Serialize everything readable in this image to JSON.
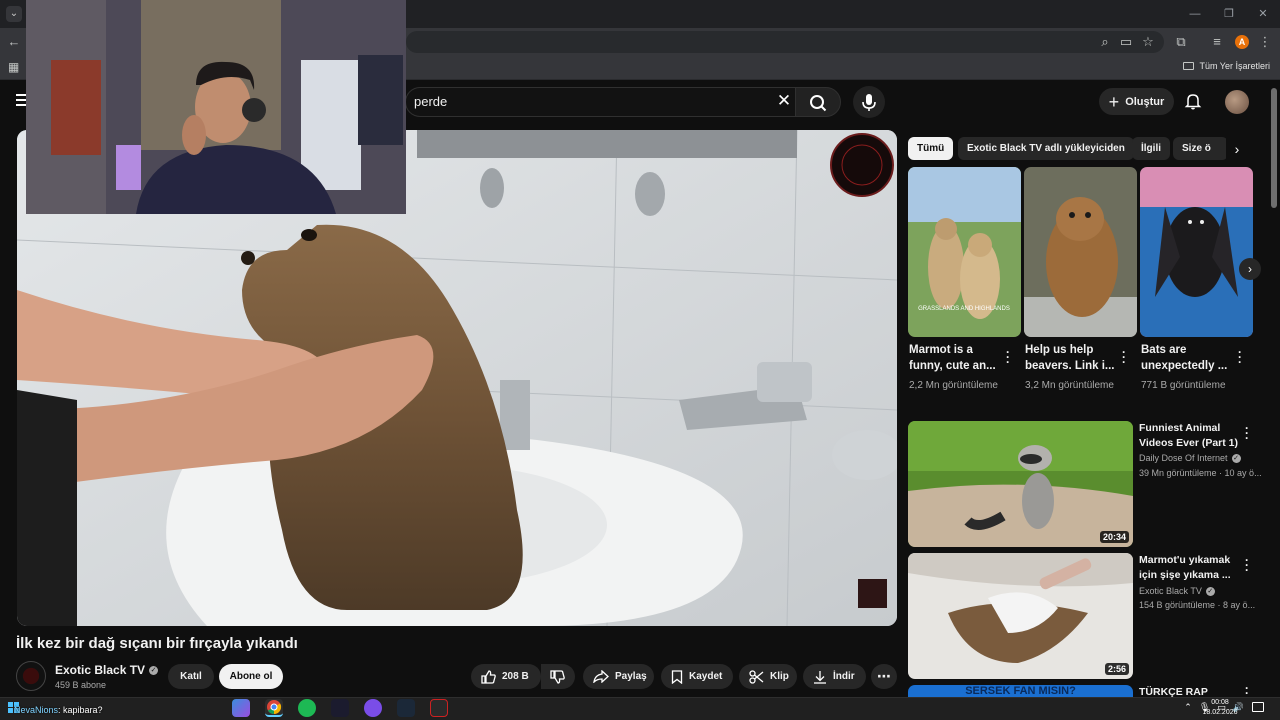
{
  "browser": {
    "bookmarks_all_label": "Tüm Yer İşaretleri",
    "profile_initial": "A"
  },
  "header": {
    "search_value": "perde",
    "create_label": "Oluştur"
  },
  "video": {
    "title": "İlk kez bir dağ sıçanı bir fırçayla yıkandı",
    "channel": "Exotic Black TV",
    "subscribers": "459 B abone",
    "join_label": "Katıl",
    "subscribe_label": "Abone ol",
    "likes": "208 B",
    "share_label": "Paylaş",
    "save_label": "Kaydet",
    "clip_label": "Klip",
    "download_label": "İndir"
  },
  "chips": [
    "Tümü",
    "Exotic Black TV adlı yükleyiciden",
    "İlgili",
    "Size ö"
  ],
  "shorts": [
    {
      "title": "Marmot is a funny, cute an...",
      "views": "2,2 Mn görüntüleme",
      "overlay": "GRASSLANDS AND HIGHLANDS"
    },
    {
      "title": "Help us help beavers. Link i...",
      "views": "3,2 Mn görüntüleme"
    },
    {
      "title": "Bats are unexpectedly ...",
      "views": "771 B görüntüleme"
    }
  ],
  "videos": [
    {
      "title": "Funniest Animal Videos Ever (Part 1)",
      "channel": "Daily Dose Of Internet",
      "meta": "39 Mn görüntüleme · 10 ay ö...",
      "duration": "20:34"
    },
    {
      "title": "Marmot'u yıkamak için şişe yıkama ...",
      "channel": "Exotic Black TV",
      "meta": "154 B görüntüleme · 8 ay ö...",
      "duration": "2:56"
    },
    {
      "title": "TÜRKÇE RAP QUIZ:",
      "banner": "SERSEK FAN MISIN?"
    }
  ],
  "stream_chat": {
    "user": "NevaNions",
    "message": ": kapibara?"
  },
  "taskbar": {
    "time": "00:08",
    "date": "18.02.2026"
  }
}
